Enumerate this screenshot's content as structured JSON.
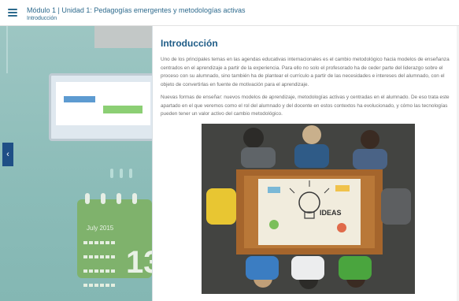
{
  "header": {
    "menu_icon": "hamburger-menu-icon",
    "title": "Módulo 1 | Unidad 1: Pedagogías emergentes y metodologías activas",
    "subtitle": "Introducción"
  },
  "background": {
    "calendar_month": "July 2015",
    "calendar_day": "13"
  },
  "nav": {
    "prev_icon": "chevron-left-icon",
    "prev_glyph": "‹"
  },
  "content": {
    "title": "Introducción",
    "paragraph1": "Uno de los principales temas en las agendas educativas internacionales es el cambio metodológico hacia modelos de enseñanza centrados en el aprendizaje a partir de la experiencia. Para ello no solo el profesorado ha de ceder parte del liderazgo sobre el proceso con su alumnado, sino también ha de plantear el currículo a partir de las necesidades e intereses del alumnado, con el objeto de convertirlas en fuente de motivación para el aprendizaje.",
    "paragraph2": "Nuevas formas de enseñar: nuevos modelos de aprendizaje, metodologías activas y centradas en el alumnado. De eso trata este apartado en el que veremos como el rol del alumnado y del docente en estos contextos ha evolucionado, y cómo las tecnologías pueden tener un valor activo del cambio metodológico.",
    "image_label": "IDEAS"
  },
  "colors": {
    "accent": "#1d5b86",
    "nav_arrow": "#1f4f86",
    "left_bg": "#8fc0bd"
  }
}
